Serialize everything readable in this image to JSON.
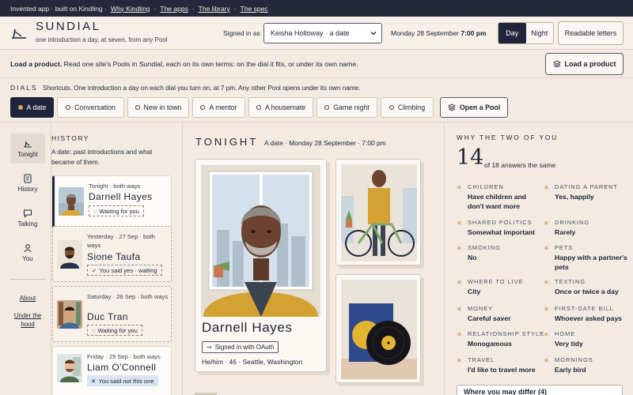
{
  "topbar": {
    "prefix": "Invented app · built on Kindling ·",
    "links": [
      "Why Kindling",
      "The apps",
      "The library",
      "The spec"
    ]
  },
  "header": {
    "brand": "SUNDIAL",
    "tagline": "one introduction a day, at seven, from any Pool",
    "signed_in_label": "Signed in as",
    "signed_in_value": "Keisha Holloway · a date",
    "date": "Monday 28 September",
    "time": "7:00 pm",
    "mode_day": "Day",
    "mode_night": "Night",
    "readable": "Readable letters"
  },
  "loadbar": {
    "title": "Load a product.",
    "text": "Read one site's Pools in Sundial, each on its own terms: on the dial it fits, or under its own name.",
    "button": "Load a product"
  },
  "dials": {
    "label": "DIALS",
    "desc": "Shortcuts. One introduction a day on each dial you turn on, at 7 pm. Any other Pool opens under its own name.",
    "items": [
      "A date",
      "Conversation",
      "New in town",
      "A mentor",
      "A housemate",
      "Game night",
      "Climbing"
    ],
    "open_pool": "Open a Pool"
  },
  "nav": {
    "tonight": "Tonight",
    "history": "History",
    "talking": "Talking",
    "you": "You",
    "about": "About",
    "under_hood": "Under the hood"
  },
  "history": {
    "title": "HISTORY",
    "desc": "A date: past introductions and what became of them.",
    "items": [
      {
        "meta": "Tonight · both ways",
        "name": "Darnell Hayes",
        "status": "Waiting for you"
      },
      {
        "meta": "Yesterday · 27 Sep · both ways",
        "name": "Sione Taufa",
        "status": "You said yes · waiting"
      },
      {
        "meta": "Saturday · 26 Sep · both ways",
        "name": "Duc Tran",
        "status": "Waiting for you"
      },
      {
        "meta": "Friday · 25 Sep · both ways",
        "name": "Liam O'Connell",
        "status": "You said not this one"
      }
    ]
  },
  "tonight": {
    "title": "TONIGHT",
    "meta": "A date · Monday 28 September · 7:00 pm",
    "name": "Darnell Hayes",
    "oauth": "Signed in with OAuth",
    "info": "He/him · 46 · Seattle, Washington"
  },
  "why": {
    "title": "WHY THE TWO OF YOU",
    "count": "14",
    "of_text": "of 18 answers the same",
    "answers": [
      {
        "k": "Children",
        "v": "Have children and don't want more"
      },
      {
        "k": "Dating a parent",
        "v": "Yes, happily"
      },
      {
        "k": "Shared politics",
        "v": "Somewhat important"
      },
      {
        "k": "Drinking",
        "v": "Rarely"
      },
      {
        "k": "Smoking",
        "v": "No"
      },
      {
        "k": "Pets",
        "v": "Happy with a partner's pets"
      },
      {
        "k": "Where to live",
        "v": "City"
      },
      {
        "k": "Texting",
        "v": "Once or twice a day"
      },
      {
        "k": "Money",
        "v": "Careful saver"
      },
      {
        "k": "First-date bill",
        "v": "Whoever asked pays"
      },
      {
        "k": "Relationship style",
        "v": "Monogamous"
      },
      {
        "k": "Home",
        "v": "Very tidy"
      },
      {
        "k": "Travel",
        "v": "I'd like to travel more"
      },
      {
        "k": "Mornings",
        "v": "Early bird"
      }
    ],
    "bottom_label": "Where you may differ (4)"
  },
  "colors": {
    "ink": "#20243a",
    "accent": "#c97b2b",
    "bg": "#f3ebe2"
  }
}
